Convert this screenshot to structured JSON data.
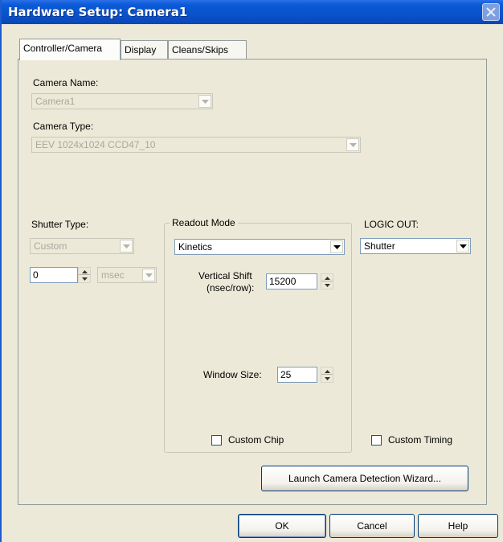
{
  "window": {
    "title": "Hardware Setup: Camera1"
  },
  "tabs": [
    {
      "label": "Controller/Camera"
    },
    {
      "label": "Display"
    },
    {
      "label": "Cleans/Skips"
    }
  ],
  "camera_name": {
    "label": "Camera Name:",
    "value": "Camera1"
  },
  "camera_type": {
    "label": "Camera Type:",
    "value": "EEV  1024x1024  CCD47_10"
  },
  "shutter": {
    "label": "Shutter Type:",
    "type_value": "Custom",
    "delay_value": "0",
    "unit_value": "msec"
  },
  "readout": {
    "group_label": "Readout Mode",
    "mode_value": "Kinetics",
    "vertical_shift_label_1": "Vertical Shift",
    "vertical_shift_label_2": "(nsec/row):",
    "vertical_shift_value": "15200",
    "window_size_label": "Window Size:",
    "window_size_value": "25"
  },
  "logic_out": {
    "label": "LOGIC OUT:",
    "value": "Shutter"
  },
  "options": {
    "custom_chip": "Custom Chip",
    "custom_timing": "Custom Timing"
  },
  "wizard_button": "Launch Camera Detection Wizard...",
  "footer": {
    "ok": "OK",
    "cancel": "Cancel",
    "help": "Help"
  }
}
